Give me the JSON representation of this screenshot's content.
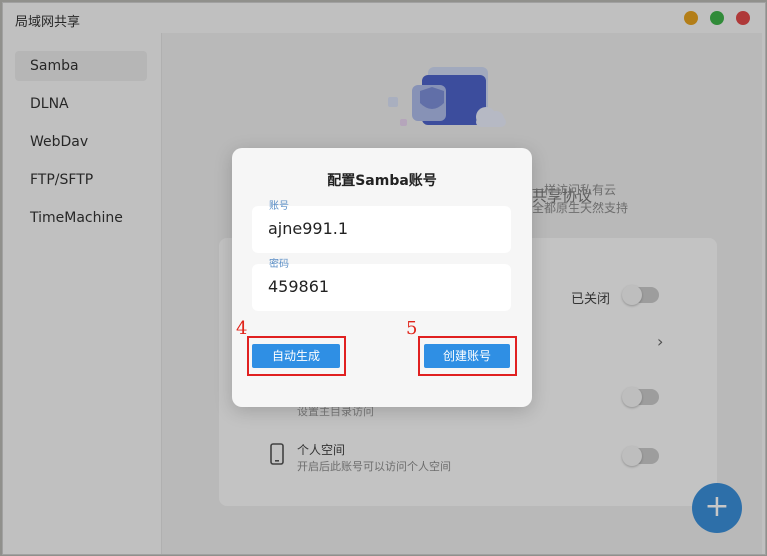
{
  "window": {
    "title": "局域网共享"
  },
  "colors": {
    "accent": "#2f8fe4",
    "highlight": "#e02020",
    "close": "#e14a4a",
    "maximize": "#3fb24a",
    "minimize": "#e6a21f"
  },
  "sidebar": {
    "items": [
      {
        "label": "Samba",
        "active": true
      },
      {
        "label": "DLNA"
      },
      {
        "label": "WebDav"
      },
      {
        "label": "FTP/SFTP"
      },
      {
        "label": "TimeMachine"
      }
    ]
  },
  "background": {
    "heading": "共享协议",
    "subtitle_line1": "一样访问私有云",
    "subtitle_line2": "全都原生天然支持",
    "status_label": "已关闭",
    "partial_text": "设置主目录访问",
    "personal_space": {
      "title": "个人空间",
      "desc": "开启后此账号可以访问个人空间"
    },
    "fab_symbol": "+",
    "icons": {
      "illustration": "folder-shield-illustration",
      "chevron": "chevron-right-icon",
      "phone": "phone-icon"
    }
  },
  "dialog": {
    "title": "配置Samba账号",
    "account": {
      "label": "账号",
      "value": "ajne991.1"
    },
    "password": {
      "label": "密码",
      "value": "459861"
    },
    "auto_generate": "自动生成",
    "create_account": "创建账号"
  },
  "annotations": {
    "step4": "4",
    "step5": "5"
  }
}
